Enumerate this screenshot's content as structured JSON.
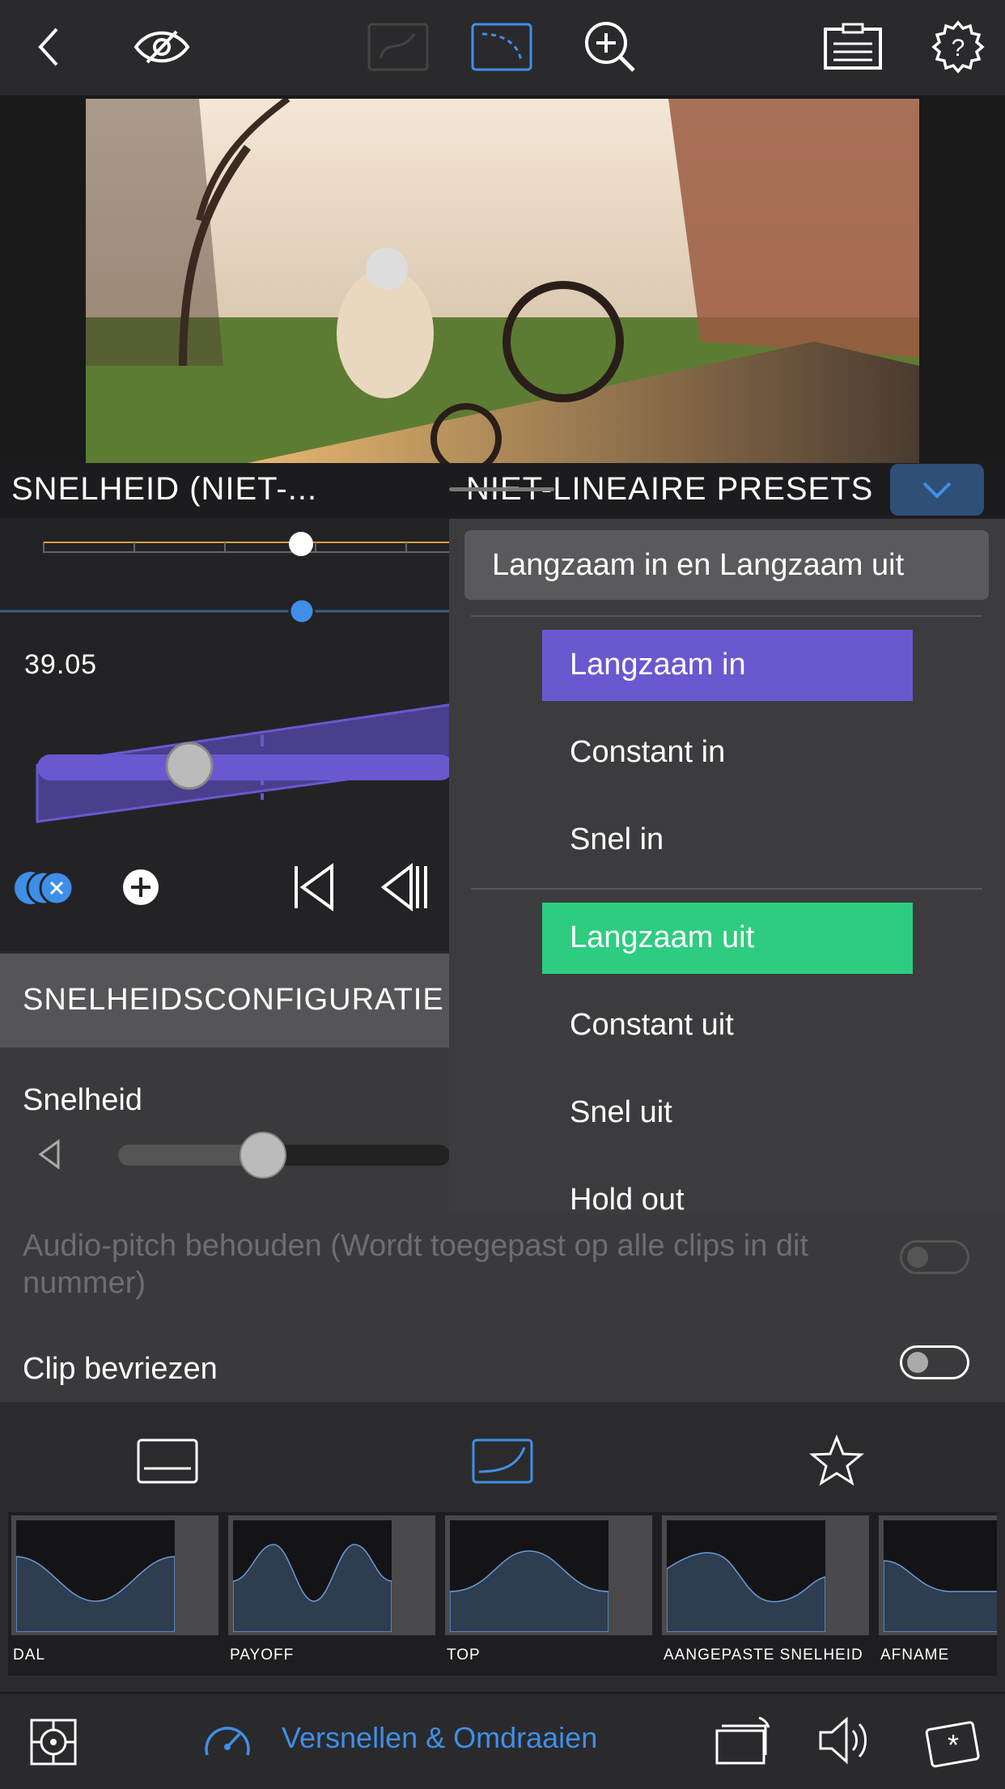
{
  "header": {
    "left_title": "SNELHEID (NIET-...",
    "right_title": "NIET-LINEAIRE PRESETS"
  },
  "toolbar": {
    "icons": [
      "back-chevron-icon",
      "eye-icon",
      "draw-mask-icon",
      "curve-icon",
      "zoom-icon",
      "clipboard-icon",
      "help-gear-icon"
    ]
  },
  "timeline": {
    "time_value": "39.05"
  },
  "config": {
    "title": "SNELHEIDSCONFIGURATIE",
    "speed_label": "Snelheid",
    "audio_pitch_label": "Audio-pitch behouden (Wordt toegepast op alle clips in dit nummer)",
    "freeze_label": "Clip bevriezen"
  },
  "dropdown": {
    "selected": "Langzaam in en Langzaam uit",
    "in_options": [
      "Langzaam in",
      "Constant in",
      "Snel in"
    ],
    "out_options": [
      "Langzaam uit",
      "Constant uit",
      "Snel uit",
      "Hold out"
    ],
    "highlight_in": "Langzaam in",
    "highlight_out": "Langzaam uit",
    "colors": {
      "in_highlight": "#6a58d0",
      "out_highlight": "#2ecc80"
    }
  },
  "presets": {
    "items": [
      {
        "label": "DAL"
      },
      {
        "label": "PAYOFF"
      },
      {
        "label": "TOP"
      },
      {
        "label": "AANGEPASTE SNELHEID"
      },
      {
        "label": "AFNAME"
      }
    ]
  },
  "bottombar": {
    "active_label": "Versnellen & Omdraaien",
    "accent": "#3f8fe8"
  }
}
